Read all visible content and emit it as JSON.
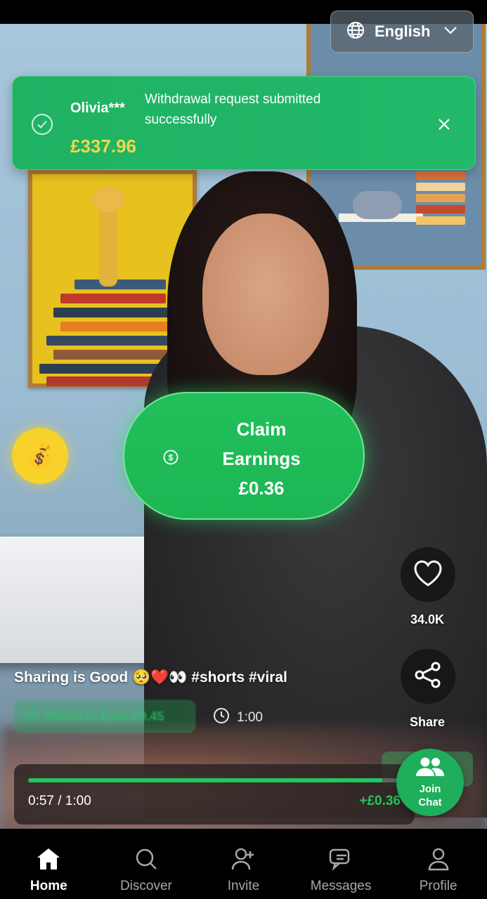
{
  "language": {
    "label": "English"
  },
  "toast": {
    "user": "Olivia***",
    "amount": "£337.96",
    "message": "Withdrawal request submitted successfully"
  },
  "claim": {
    "line1": "Claim",
    "line2": "Earnings",
    "amount": "£0.36"
  },
  "actions": {
    "likes": "34.0K",
    "share": "Share"
  },
  "video": {
    "caption": "Sharing is Good 🥺❤️👀 #shorts #viral",
    "watch_pill": "Watch to Earn £0.45",
    "duration": "1:00",
    "progress_time": "0:57 / 1:00",
    "progress_fraction": 0.95,
    "progress_earning": "+£0.36"
  },
  "join_chat": {
    "label": "Join Chat"
  },
  "nav": [
    {
      "label": "Home",
      "icon": "home-icon",
      "active": true
    },
    {
      "label": "Discover",
      "icon": "search-icon",
      "active": false
    },
    {
      "label": "Invite",
      "icon": "add-user-icon",
      "active": false
    },
    {
      "label": "Messages",
      "icon": "chat-icon",
      "active": false
    },
    {
      "label": "Profile",
      "icon": "user-icon",
      "active": false
    }
  ],
  "colors": {
    "accent_green": "#22c55e",
    "toast_green": "#1fb263",
    "amount_yellow": "#f2d64b",
    "money_bag_yellow": "#f6d22a"
  }
}
